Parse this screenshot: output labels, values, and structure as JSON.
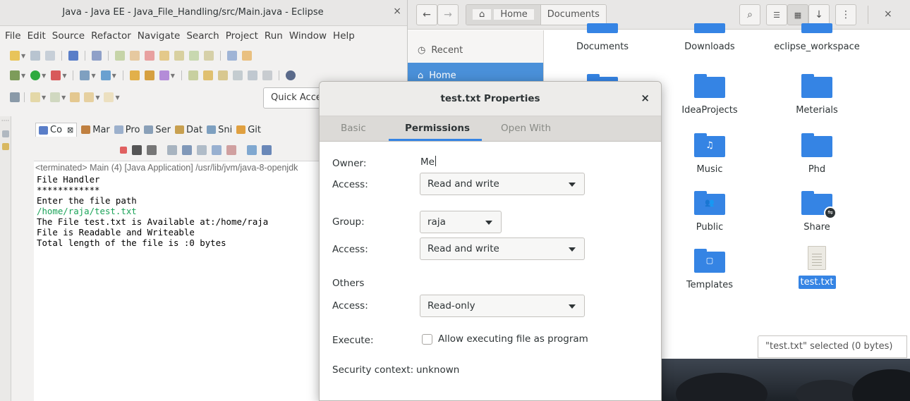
{
  "eclipse": {
    "title": "Java - Java EE - Java_File_Handling/src/Main.java - Eclipse",
    "close": "×",
    "menu": [
      "File",
      "Edit",
      "Source",
      "Refactor",
      "Navigate",
      "Search",
      "Project",
      "Run",
      "Window",
      "Help"
    ],
    "quick_access": "Quick Access",
    "view_tabs": [
      "Co",
      "Mar",
      "Pro",
      "Ser",
      "Dat",
      "Sni",
      "Git"
    ],
    "tab_close": "⊠",
    "console": {
      "status": "<terminated> Main (4) [Java Application] /usr/lib/jvm/java-8-openjdk",
      "lines": [
        "File Handler",
        "************",
        "Enter the file path",
        "/home/raja/test.txt",
        "The File test.txt is Available at:/home/raja",
        "File is Readable and Writeable",
        "Total length of the file is :0 bytes"
      ]
    }
  },
  "nautilus": {
    "path": {
      "home": "Home",
      "current": "Documents"
    },
    "sidebar": [
      "Recent",
      "Home"
    ],
    "items": [
      "Documents",
      "Downloads",
      "eclipse_workspace",
      "IdeaProjects",
      "Meterials",
      "Music",
      "Phd",
      "Public",
      "Share",
      "Templates",
      "test.txt"
    ],
    "status": "\"test.txt\" selected (0 bytes)",
    "folder_color": "#3584e4"
  },
  "dialog": {
    "title": "test.txt Properties",
    "close": "×",
    "tabs": [
      "Basic",
      "Permissions",
      "Open With"
    ],
    "owner_label": "Owner:",
    "owner_value": "Me",
    "owner_access_label": "Access:",
    "owner_access": "Read and write",
    "group_label": "Group:",
    "group_value": "raja",
    "group_access_label": "Access:",
    "group_access": "Read and write",
    "others_label": "Others",
    "others_access_label": "Access:",
    "others_access": "Read-only",
    "execute_label": "Execute:",
    "execute_text": "Allow executing file as program",
    "security_label": "Security context:",
    "security_value": "unknown",
    "accent": "#3584e4"
  }
}
